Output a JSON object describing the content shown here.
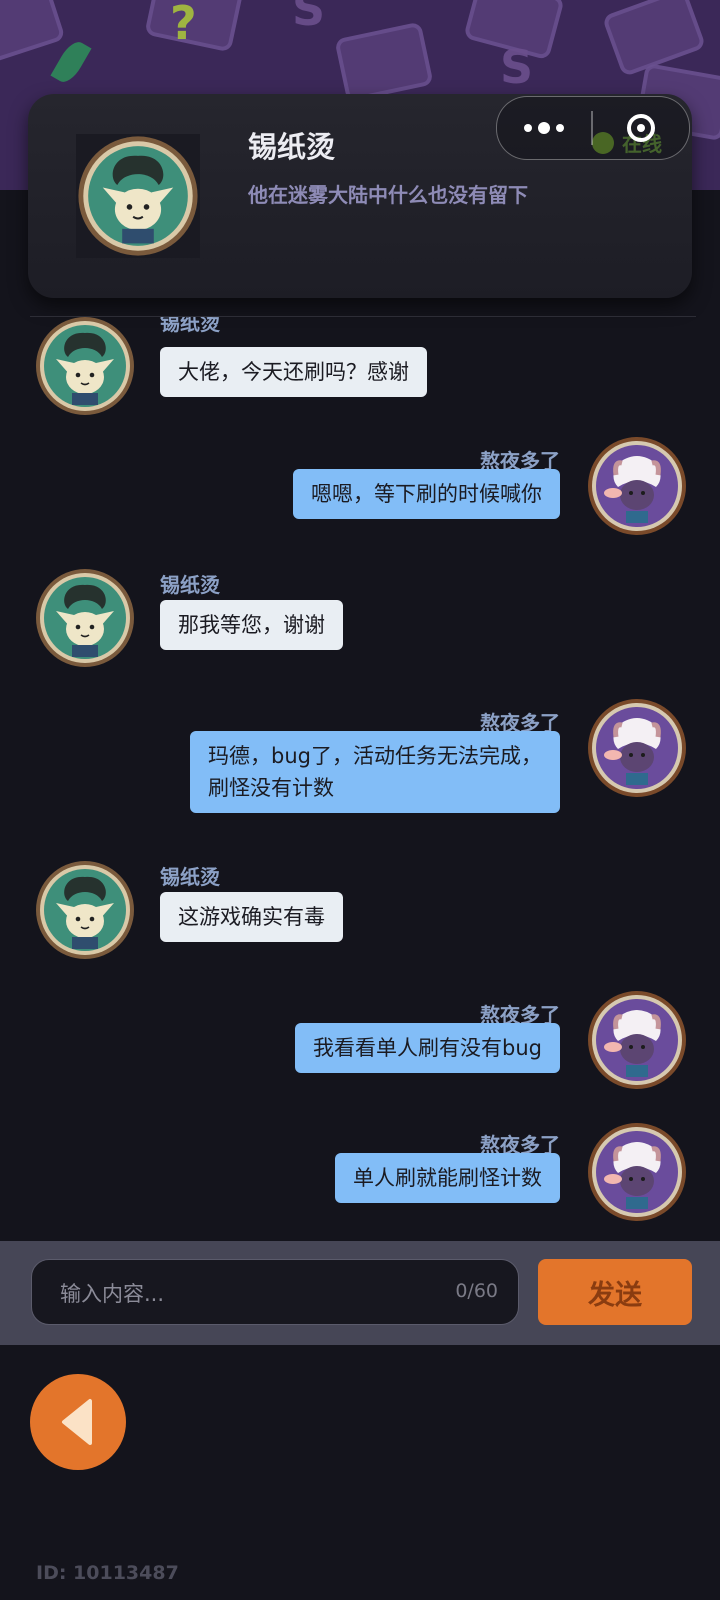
{
  "header": {
    "name": "锡纸烫",
    "motto": "他在迷雾大陆中什么也没有留下",
    "status": "在线"
  },
  "capsule": {
    "menu_icon": "more-dots-icon",
    "close_icon": "target-circle-icon"
  },
  "messages": [
    {
      "side": "left",
      "sender": "锡纸烫",
      "text": "大佬，今天还刷吗？感谢"
    },
    {
      "side": "right",
      "sender": "熬夜多了",
      "text": "嗯嗯，等下刷的时候喊你"
    },
    {
      "side": "left",
      "sender": "锡纸烫",
      "text": "那我等您，谢谢"
    },
    {
      "side": "right",
      "sender": "熬夜多了",
      "text": "玛德，bug了，活动任务无法完成，\n刷怪没有计数"
    },
    {
      "side": "left",
      "sender": "锡纸烫",
      "text": "这游戏确实有毒"
    },
    {
      "side": "right",
      "sender": "熬夜多了",
      "text": "我看看单人刷有没有bug"
    },
    {
      "side": "right",
      "sender": "熬夜多了",
      "text": "单人刷就能刷怪计数"
    }
  ],
  "input": {
    "placeholder": "输入内容...",
    "counter": "0/60"
  },
  "send_label": "发送",
  "back_icon": "back-triangle-icon",
  "user_id": "ID: 10113487",
  "colors": {
    "accent": "#e3752b",
    "self_bubble": "#82bdf7",
    "other_bubble": "#e9eef3",
    "online": "#8acb2f",
    "background": "#14141c"
  }
}
